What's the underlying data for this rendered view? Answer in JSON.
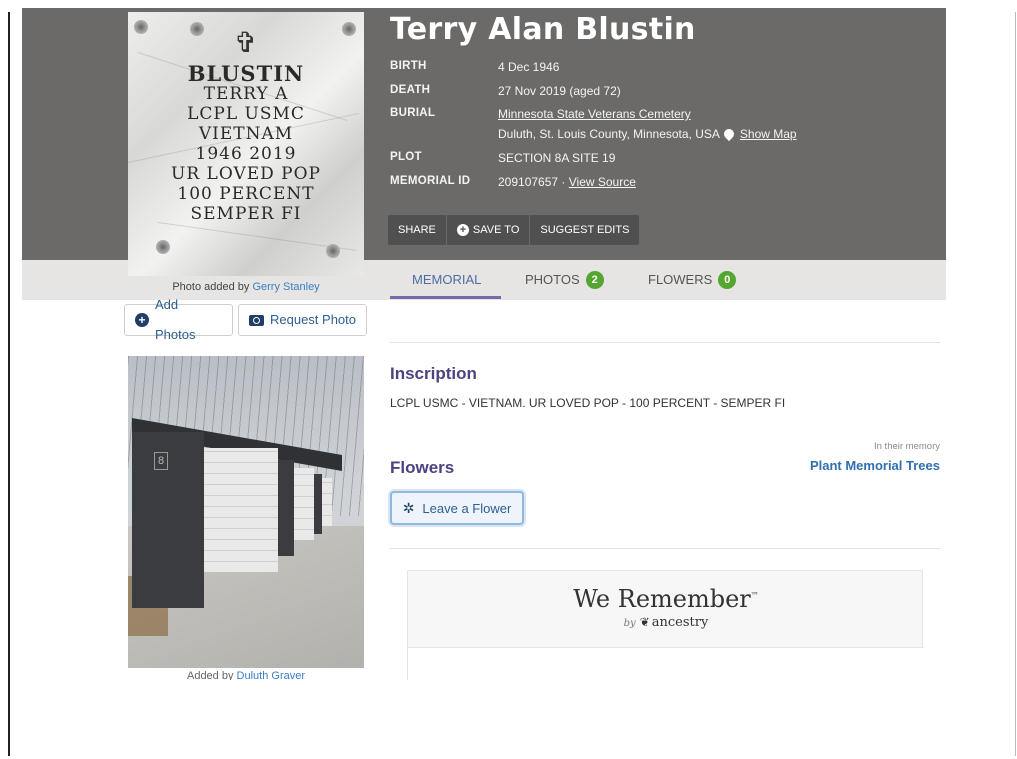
{
  "person": {
    "name": "Terry Alan Blustin"
  },
  "facts": {
    "birth_label": "BIRTH",
    "birth_value": "4 Dec 1946",
    "death_label": "DEATH",
    "death_value": "27 Nov 2019 (aged 72)",
    "burial_label": "BURIAL",
    "burial_cemetery": "Minnesota State Veterans Cemetery",
    "burial_location": "Duluth, St. Louis County, Minnesota, USA",
    "show_map": "Show Map",
    "plot_label": "PLOT",
    "plot_value": "SECTION 8A SITE 19",
    "memorial_id_label": "MEMORIAL ID",
    "memorial_id_value": "209107657 · ",
    "view_source": "View Source"
  },
  "actions": {
    "share": "SHARE",
    "save_to": "SAVE TO",
    "suggest_edits": "SUGGEST EDITS"
  },
  "tabs": {
    "memorial": "MEMORIAL",
    "photos": "PHOTOS",
    "photos_count": "2",
    "flowers": "FLOWERS",
    "flowers_count": "0"
  },
  "headstone": {
    "line1": "BLUSTIN",
    "line2": "TERRY A",
    "line3": "LCPL  USMC",
    "line4": "VIETNAM",
    "line5": "1946   2019",
    "line6": "UR LOVED POP",
    "line7": "100 PERCENT",
    "line8": "SEMPER FI",
    "cross": "✞"
  },
  "photo_credit": {
    "prefix": "Photo added by ",
    "name": "Gerry Stanley"
  },
  "buttons": {
    "add_photos": "Add Photos",
    "request_photo": "Request Photo",
    "leave_flower": "Leave a Flower"
  },
  "second_photo": {
    "pillar_number": "8",
    "prefix": "Added by ",
    "name": "Duluth Graver"
  },
  "inscription": {
    "heading": "Inscription",
    "text": "LCPL USMC - VIETNAM. UR LOVED POP - 100 PERCENT - SEMPER FI"
  },
  "flowers_section": {
    "heading": "Flowers",
    "memory_label": "In their memory",
    "plant_trees": "Plant Memorial Trees"
  },
  "we_remember": {
    "title": "We Remember",
    "tm": "™",
    "by": "by",
    "brand": "ancestry"
  },
  "icons": {
    "plus": "+",
    "flower": "✲",
    "leaf": "❦"
  }
}
